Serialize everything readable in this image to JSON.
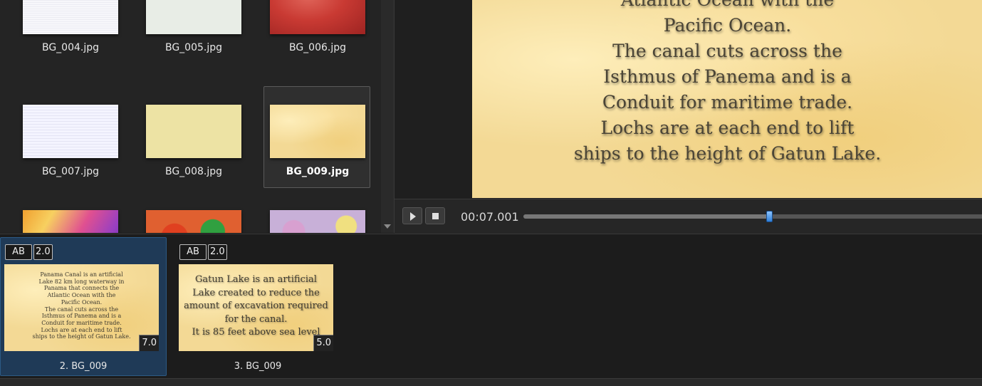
{
  "library": {
    "items": [
      {
        "label": "BG_004.jpg",
        "texture": "tex-004",
        "selected": false
      },
      {
        "label": "BG_005.jpg",
        "texture": "tex-005",
        "selected": false
      },
      {
        "label": "BG_006.jpg",
        "texture": "tex-006",
        "selected": false
      },
      {
        "label": "BG_007.jpg",
        "texture": "tex-007",
        "selected": false
      },
      {
        "label": "BG_008.jpg",
        "texture": "tex-008",
        "selected": false
      },
      {
        "label": "BG_009.jpg",
        "texture": "tex-009",
        "selected": true
      },
      {
        "label": "",
        "texture": "tex-010",
        "selected": false
      },
      {
        "label": "",
        "texture": "tex-011",
        "selected": false
      },
      {
        "label": "",
        "texture": "tex-012",
        "selected": false
      }
    ]
  },
  "preview": {
    "lines": [
      "Atlantic Ocean with the",
      "Pacific Ocean.",
      "The canal cuts across the",
      "Isthmus of Panema and is a",
      "Conduit for maritime trade.",
      "Lochs are at each end to lift",
      "ships to the height of Gatun Lake."
    ],
    "timecode": "00:07.001",
    "progress": 0.53
  },
  "timeline": {
    "clips": [
      {
        "transition_label": "AB",
        "transition_duration": "2.0",
        "duration": "7.0",
        "label": "2. BG_009",
        "selected": true,
        "text_size": "small",
        "lines": [
          "Panama Canal is an artificial",
          "Lake 82 km long waterway in",
          "Panama that connects the",
          "Atlantic Ocean with the",
          "Pacific Ocean.",
          "The canal cuts across the",
          "Isthmus of Panema and is a",
          "Conduit for maritime trade.",
          "Lochs are at each end to lift",
          "ships to the height of Gatun Lake."
        ]
      },
      {
        "transition_label": "AB",
        "transition_duration": "2.0",
        "duration": "5.0",
        "label": "3. BG_009",
        "selected": false,
        "text_size": "large",
        "lines": [
          "Gatun Lake is an artificial",
          "Lake created to reduce the",
          "amount of excavation required",
          "for the canal.",
          "It is 85 feet above sea level"
        ]
      }
    ]
  },
  "colors": {
    "accent": "#2f7fd8",
    "selection": "#1f3a57"
  }
}
